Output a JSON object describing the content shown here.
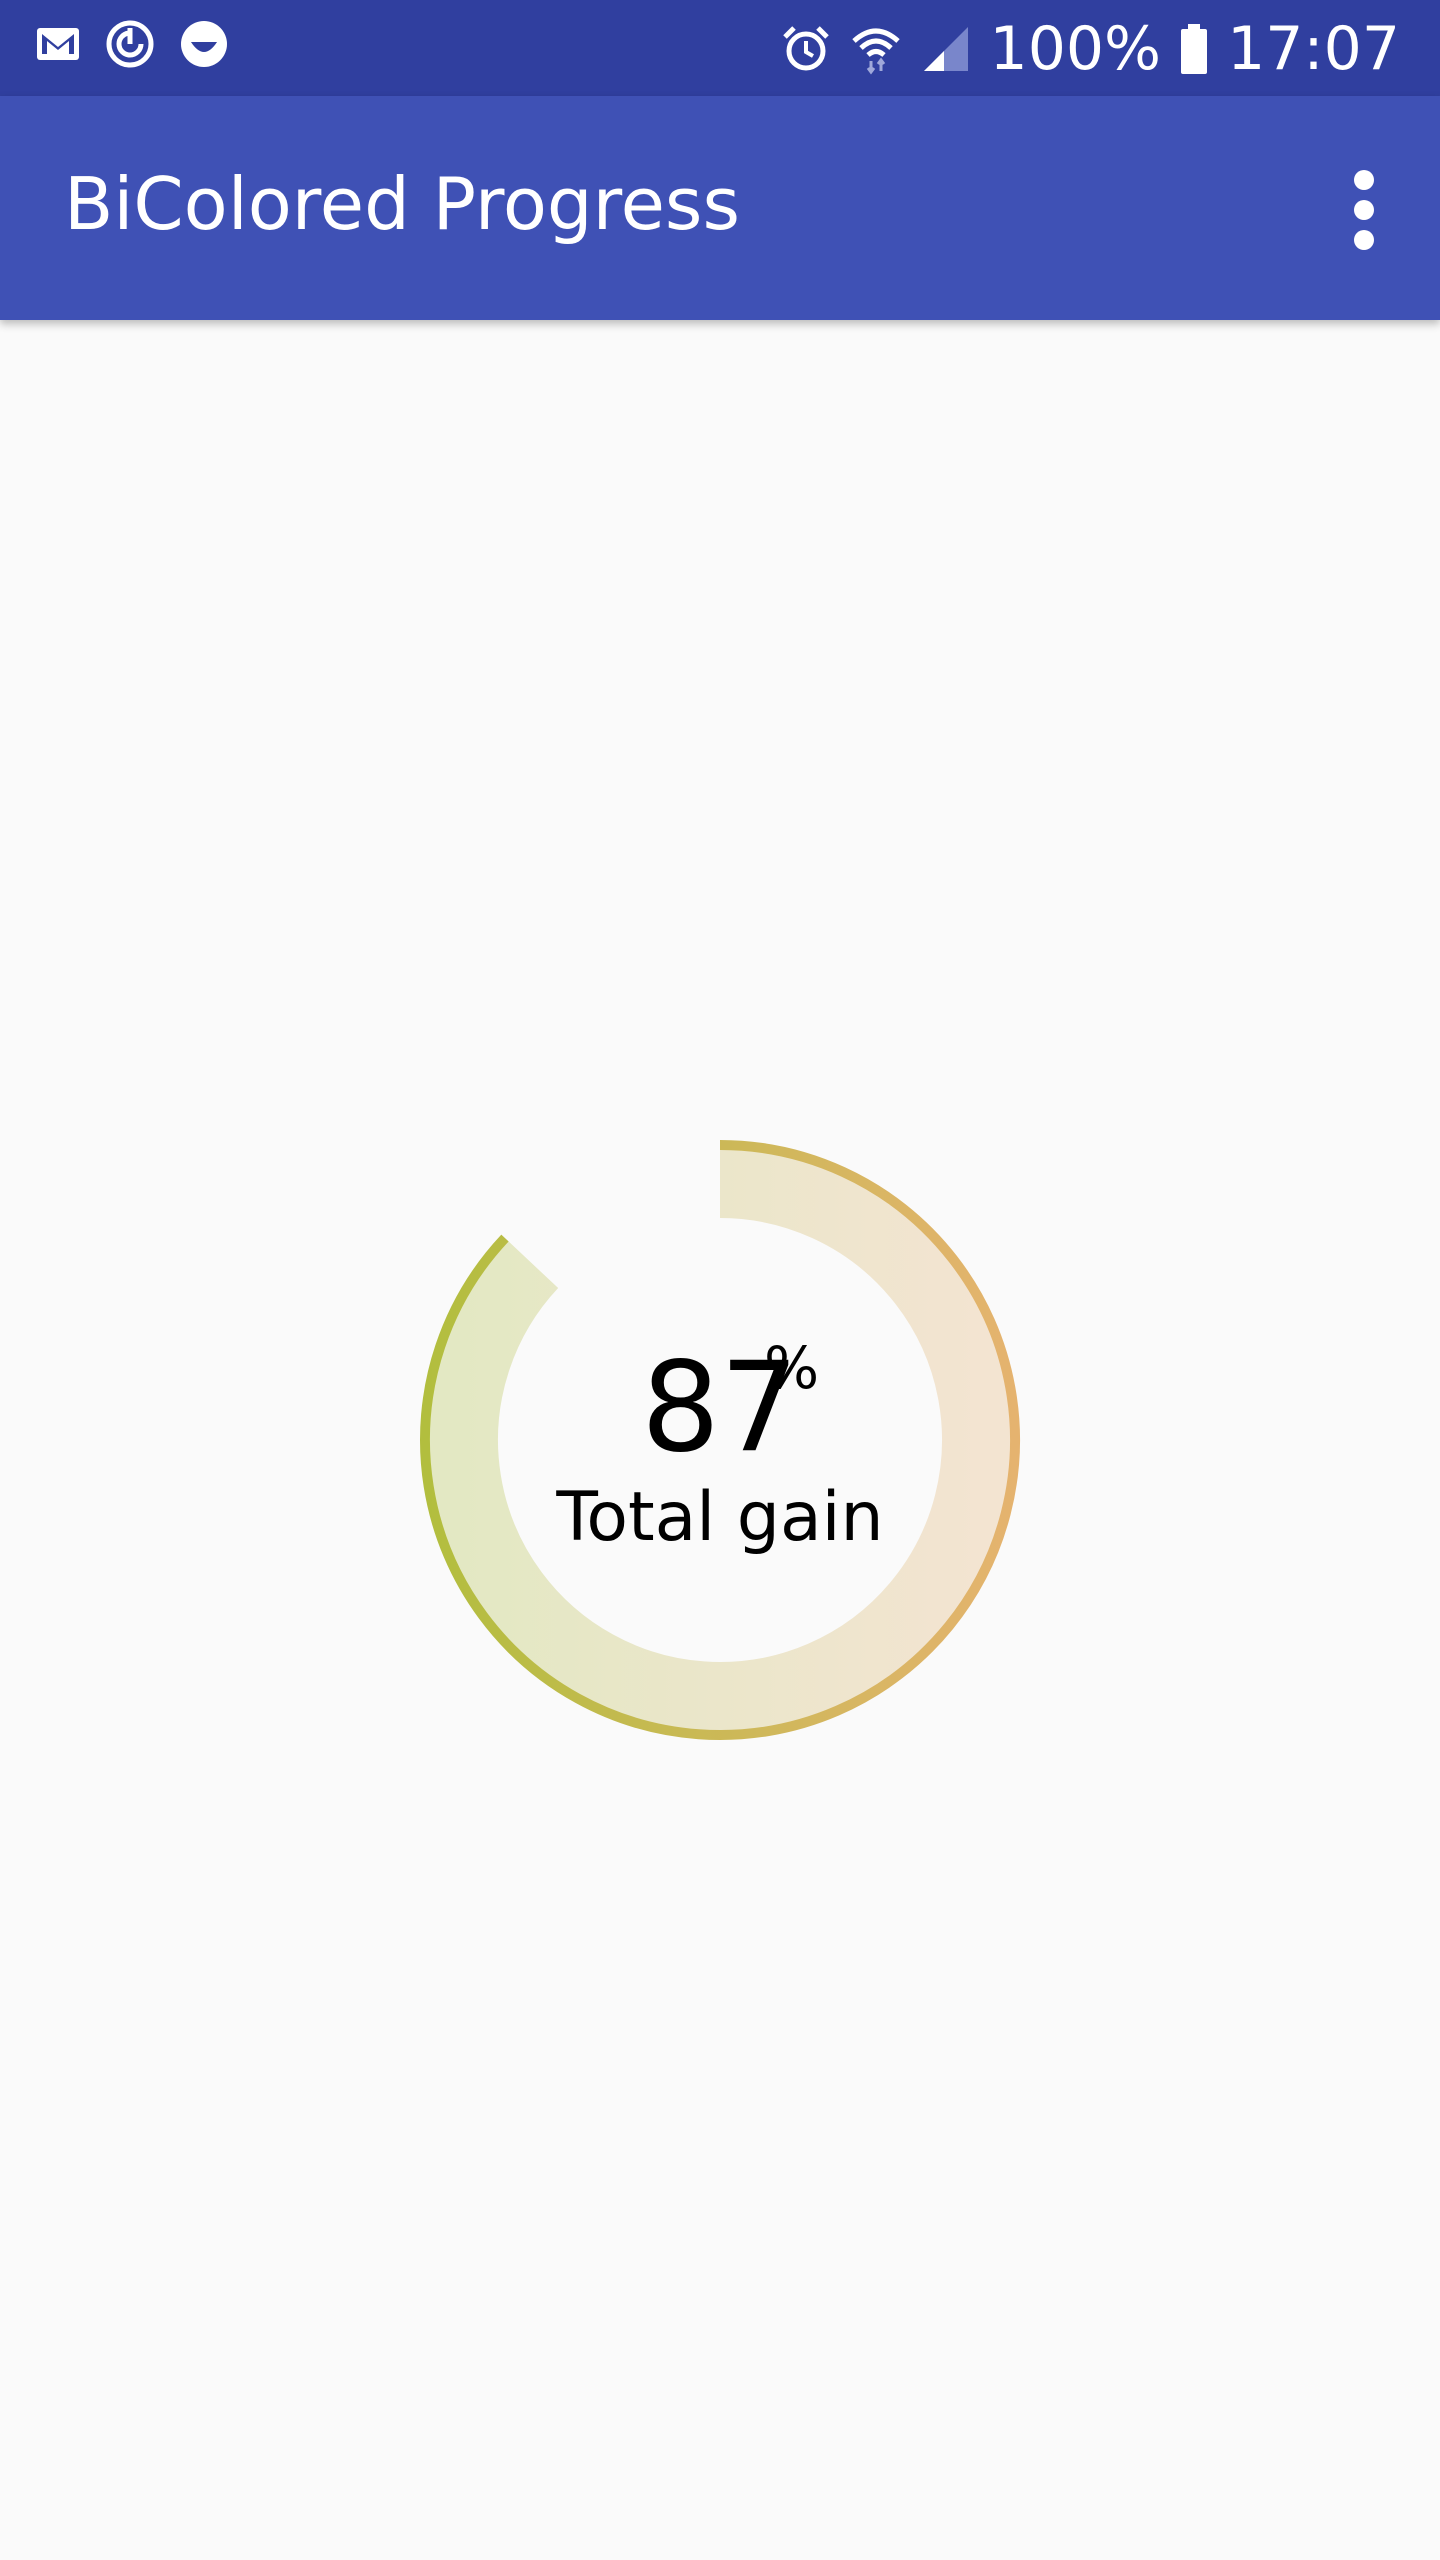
{
  "status_bar": {
    "battery": "100%",
    "time": "17:07",
    "background": "#303f9f",
    "left_icons": [
      "gmail-icon",
      "sync-icon",
      "face-icon"
    ],
    "right_icons": [
      "alarm-icon",
      "wifi-icon",
      "signal-icon",
      "battery-icon"
    ]
  },
  "app_bar": {
    "title": "BiColored Progress",
    "background": "#3f51b5",
    "menu_icon": "more-vert-icon"
  },
  "progress": {
    "value": 87,
    "value_text": "87",
    "unit": "%",
    "label": "Total gain",
    "start_color": "#b2be3e",
    "end_color": "#e5b36f",
    "track_start_color": "#e3e8c3",
    "track_end_color": "#f3e4d1"
  }
}
